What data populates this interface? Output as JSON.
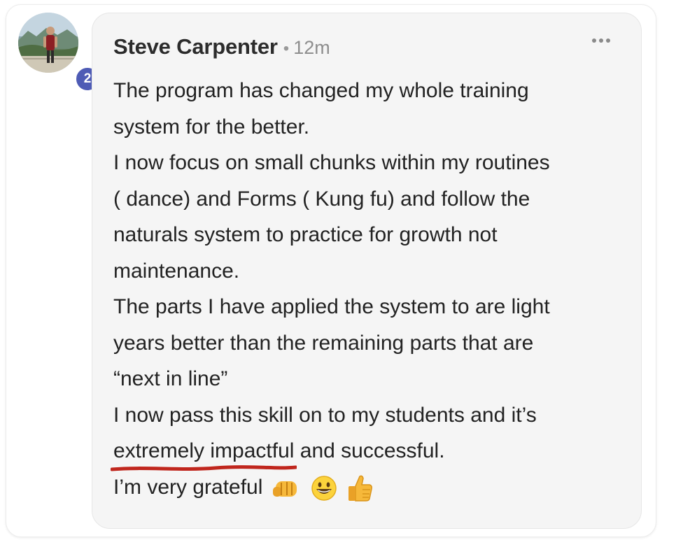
{
  "post": {
    "author": "Steve Carpenter",
    "separator": "•",
    "time": "12m",
    "badge_count": "2",
    "lines": [
      "The program has changed my whole training",
      "system for the better.",
      "I now focus on small chunks within my routines",
      "( dance) and Forms ( Kung fu) and follow the",
      "naturals system to practice for growth not",
      "maintenance.",
      "The parts I have applied the system to are light",
      "years better than the remaining parts that are",
      "“next in line”",
      "I now pass this skill on to my students and it’s"
    ],
    "highlight_text": "extremely impactful",
    "after_highlight": " and successful.",
    "last_line": "I’m very grateful",
    "emojis": [
      "fist-bump-emoji",
      "grinning-face-emoji",
      "thumbs-up-emoji"
    ]
  },
  "colors": {
    "badge": "#4e5bb5",
    "underline": "#c0261d",
    "bubble": "#f5f5f5"
  }
}
